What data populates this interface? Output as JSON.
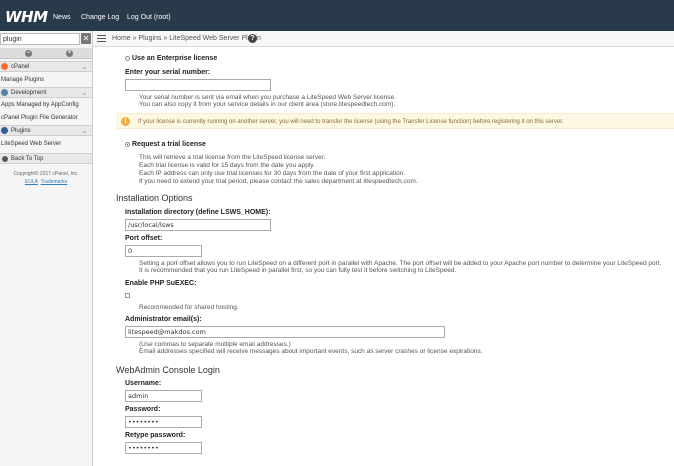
{
  "header": {
    "logo": "WHM",
    "nav": [
      "News",
      "Change Log",
      "Log Out (root)"
    ]
  },
  "sidebar": {
    "search_value": "plugin",
    "clear_label": "✕",
    "collapse_label": "−",
    "expand_label": "+",
    "categories": [
      {
        "label": "cPanel",
        "items": [
          "Manage Plugins"
        ]
      },
      {
        "label": "Development",
        "items": [
          "Apps Managed by AppConfig",
          "cPanel Plugin File Generator"
        ]
      },
      {
        "label": "Plugins",
        "items": [
          "LiteSpeed Web Server"
        ]
      }
    ],
    "back_to_top": "Back To Top",
    "copyright": "Copyright© 2017 cPanel, Inc.",
    "eula": "EULA",
    "trademarks": "Trademarks"
  },
  "breadcrumb": "Home » Plugins » LiteSpeed Web Server Plugin",
  "help_glyph": "?",
  "enterprise": {
    "radio_label": "Use an Enterprise license",
    "serial_label": "Enter your serial number:",
    "serial_value": "",
    "hint1": "Your serial number is sent via email when you purchase a LiteSpeed Web Server license.",
    "hint2": "You can also copy it from your service details in our client area (store.litespeedtech.com)."
  },
  "alert": {
    "icon": "!",
    "text": "If your license is currently running on another server, you will need to transfer the license (using the Transfer License function) before registering it on this server."
  },
  "trial": {
    "radio_label": "Request a trial license",
    "lines": [
      "This will retrieve a trial license from the LiteSpeed license server.",
      "Each trial license is valid for 15 days from the date you apply.",
      "Each IP address can only use trial licenses for 30 days from the date of your first application.",
      "If you need to extend your trial period, please contact the sales department at litespeedtech.com."
    ]
  },
  "install": {
    "title": "Installation Options",
    "dir_label": "Installation directory (define LSWS_HOME):",
    "dir_value": "/usr/local/lsws",
    "port_label": "Port offset:",
    "port_value": "0",
    "port_hint1": "Setting a port offset allows you to run LiteSpeed on a different port in parallel with Apache. The port offset will be added to your Apache port number to determine your LiteSpeed port.",
    "port_hint2": "It is recommended that you run LiteSpeed in parallel first, so you can fully test it before switching to LiteSpeed.",
    "suexec_label": "Enable PHP SuEXEC:",
    "suexec_hint": "Recommended for shared hosting.",
    "email_label": "Administrator email(s):",
    "email_value": "litespeed@makdos.com",
    "email_hint1": "(Use commas to separate multiple email addresses.)",
    "email_hint2": "Email addresses specified will receive messages about important events, such as server crashes or license expirations."
  },
  "webadmin": {
    "title": "WebAdmin Console Login",
    "user_label": "Username:",
    "user_value": "admin",
    "pass_label": "Password:",
    "pass_value": "••••••••",
    "retype_label": "Retype password:",
    "retype_value": "••••••••"
  }
}
